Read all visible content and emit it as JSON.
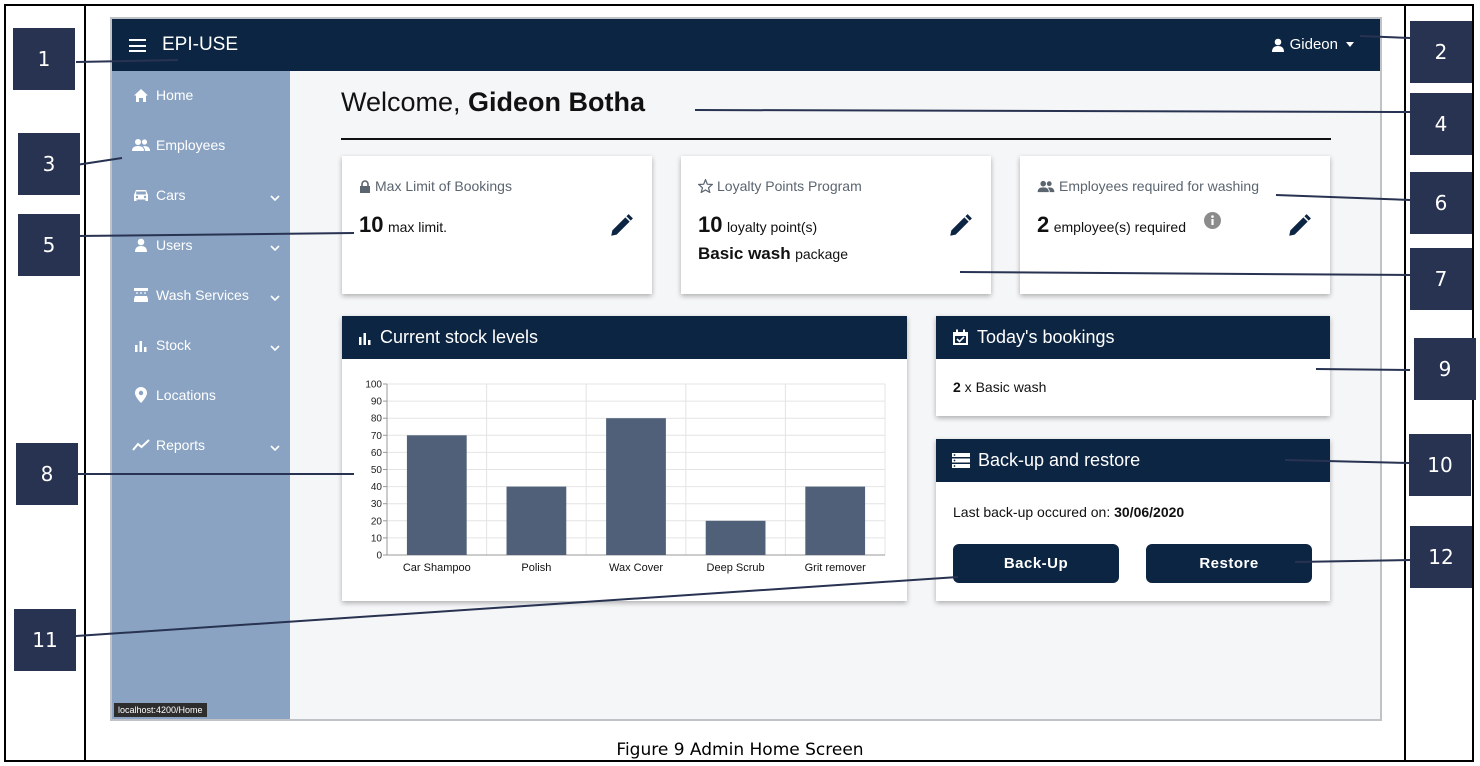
{
  "figure_caption": "Figure 9 Admin Home Screen",
  "callouts": [
    "1",
    "2",
    "3",
    "4",
    "5",
    "6",
    "7",
    "8",
    "9",
    "10",
    "11",
    "12"
  ],
  "app": {
    "brand": "EPI-USE",
    "user": "Gideon",
    "status_url": "localhost:4200/Home"
  },
  "sidebar": {
    "items": [
      {
        "label": "Home",
        "icon": "home-icon",
        "has_chevron": false
      },
      {
        "label": "Employees",
        "icon": "people-icon",
        "has_chevron": false
      },
      {
        "label": "Cars",
        "icon": "car-icon",
        "has_chevron": true
      },
      {
        "label": "Users",
        "icon": "user-icon",
        "has_chevron": true
      },
      {
        "label": "Wash Services",
        "icon": "wash-icon",
        "has_chevron": true
      },
      {
        "label": "Stock",
        "icon": "bar-chart-icon",
        "has_chevron": true
      },
      {
        "label": "Locations",
        "icon": "location-pin-icon",
        "has_chevron": false
      },
      {
        "label": "Reports",
        "icon": "trend-line-icon",
        "has_chevron": true
      }
    ]
  },
  "welcome": {
    "prefix": "Welcome, ",
    "name": "Gideon Botha"
  },
  "cards": {
    "max_bookings": {
      "title": "Max Limit of Bookings",
      "value": "10",
      "suffix": "max limit."
    },
    "loyalty": {
      "title": "Loyalty Points Program",
      "value": "10",
      "suffix": "loyalty point(s)",
      "package_name": "Basic wash",
      "package_suffix": "package"
    },
    "employees": {
      "title": "Employees required for washing",
      "value": "2",
      "suffix": "employee(s) required"
    }
  },
  "stock_panel": {
    "title": "Current stock levels"
  },
  "bookings_panel": {
    "title": "Today's bookings",
    "count": "2",
    "text": " x Basic wash"
  },
  "backup_panel": {
    "title": "Back-up and restore",
    "last_label": "Last back-up occured on: ",
    "last_date": "30/06/2020",
    "backup_label": "Back-Up",
    "restore_label": "Restore"
  },
  "colors": {
    "navbar": "#0c2542",
    "sidebar": "#8aa3c2",
    "bar": "#4f6078",
    "callout": "#283251"
  },
  "chart_data": {
    "type": "bar",
    "categories": [
      "Car Shampoo",
      "Polish",
      "Wax Cover",
      "Deep Scrub",
      "Grit remover"
    ],
    "values": [
      70,
      40,
      80,
      20,
      40
    ],
    "yticks": [
      0,
      10,
      20,
      30,
      40,
      50,
      60,
      70,
      80,
      90,
      100
    ],
    "ylim": [
      0,
      100
    ],
    "grid": true
  }
}
